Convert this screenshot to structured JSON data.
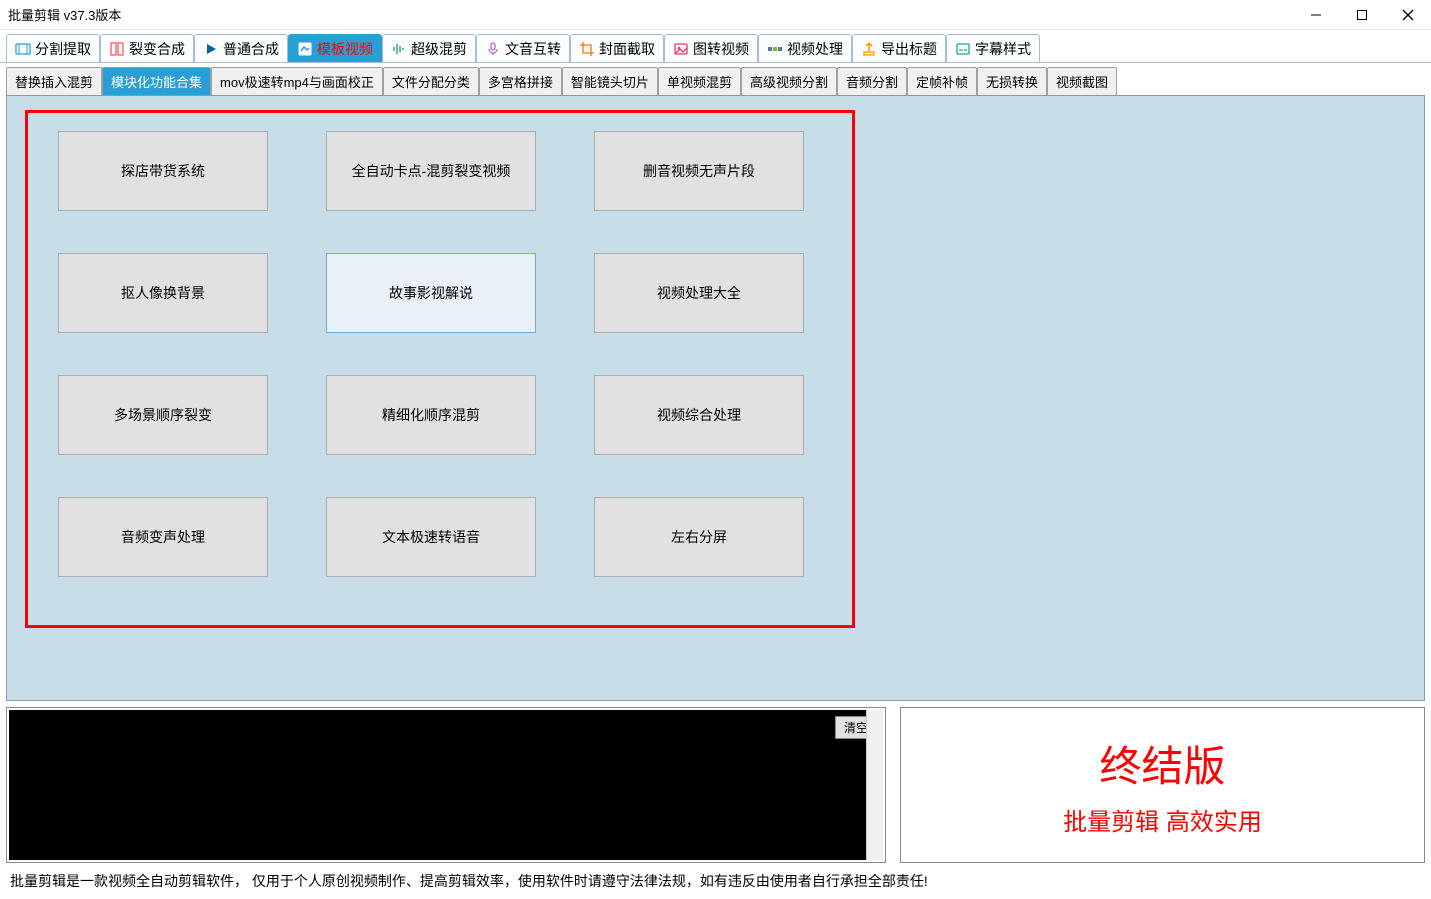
{
  "window": {
    "title": "批量剪辑   v37.3版本"
  },
  "main_tabs": [
    {
      "icon": "film",
      "label": "分割提取",
      "color": "#2a9fd6"
    },
    {
      "icon": "split",
      "label": "裂变合成",
      "color": "#ff5a5a"
    },
    {
      "icon": "play",
      "label": "普通合成",
      "color": "#069"
    },
    {
      "icon": "template",
      "label": "模板视频",
      "color": "#ff0000",
      "active": true
    },
    {
      "icon": "waveform",
      "label": "超级混剪",
      "color": "#3a7"
    },
    {
      "icon": "mic",
      "label": "文音互转",
      "color": "#b6c"
    },
    {
      "icon": "crop",
      "label": "封面截取",
      "color": "#f70"
    },
    {
      "icon": "image",
      "label": "图转视频",
      "color": "#f36"
    },
    {
      "icon": "process",
      "label": "视频处理",
      "color": "#57a"
    },
    {
      "icon": "export",
      "label": "导出标题",
      "color": "#f90"
    },
    {
      "icon": "subtitle",
      "label": "字幕样式",
      "color": "#2a8"
    }
  ],
  "sub_tabs": [
    {
      "label": "替换插入混剪"
    },
    {
      "label": "模块化功能合集",
      "active": true
    },
    {
      "label": "mov极速转mp4与画面校正"
    },
    {
      "label": "文件分配分类"
    },
    {
      "label": "多宫格拼接"
    },
    {
      "label": "智能镜头切片"
    },
    {
      "label": "单视频混剪"
    },
    {
      "label": "高级视频分割"
    },
    {
      "label": "音频分割"
    },
    {
      "label": "定帧补帧"
    },
    {
      "label": "无损转换"
    },
    {
      "label": "视频截图"
    }
  ],
  "grid_buttons": [
    "探店带货系统",
    "全自动卡点-混剪裂变视频",
    "删音视频无声片段",
    "抠人像换背景",
    "故事影视解说",
    "视频处理大全",
    "多场景顺序裂变",
    "精细化顺序混剪",
    "视频综合处理",
    "音频变声处理",
    "文本极速转语音",
    "左右分屏"
  ],
  "grid_highlight_index": 4,
  "log": {
    "clear_label": "清空"
  },
  "version_box": {
    "title": "终结版",
    "subtitle": "批量剪辑 高效实用"
  },
  "footer": "批量剪辑是一款视频全自动剪辑软件，   仅用于个人原创视频制作、提高剪辑效率，使用软件时请遵守法律法规，如有违反由使用者自行承担全部责任!"
}
